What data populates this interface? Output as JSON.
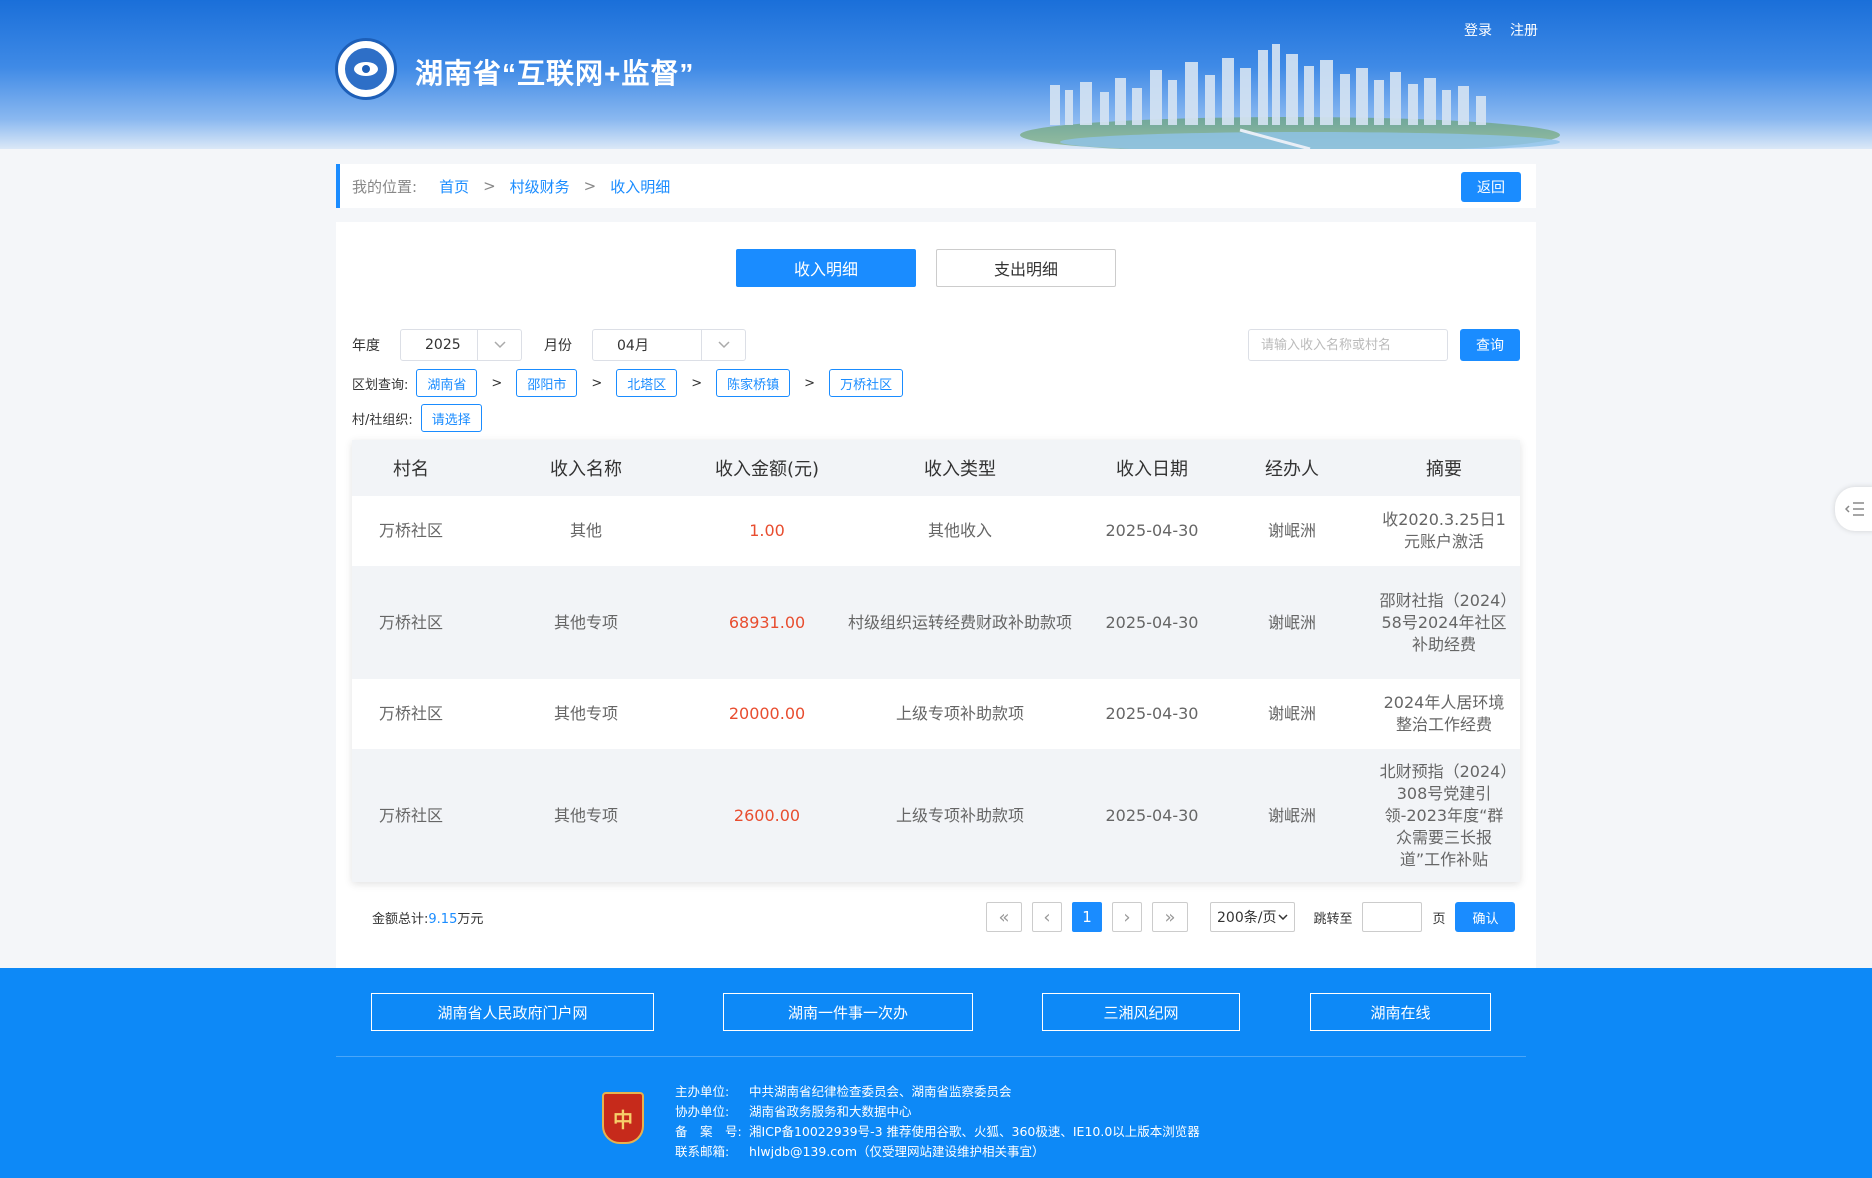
{
  "header": {
    "site_title": "湖南省“互联网+监督”",
    "login": "登录",
    "register": "注册"
  },
  "breadcrumb": {
    "label": "我的位置:",
    "items": [
      "首页",
      "村级财务",
      "收入明细"
    ],
    "separator": ">",
    "back": "返回"
  },
  "tabs": [
    {
      "label": "收入明细",
      "active": true
    },
    {
      "label": "支出明细",
      "active": false
    }
  ],
  "filters": {
    "year_label": "年度",
    "year_value": "2025",
    "month_label": "月份",
    "month_value": "04月",
    "search_placeholder": "请输入收入名称或村名",
    "query": "查询",
    "region_label": "区划查询:",
    "regions": [
      "湖南省",
      "邵阳市",
      "北塔区",
      "陈家桥镇",
      "万桥社区"
    ],
    "org_label": "村/社组织:",
    "org_value": "请选择"
  },
  "table": {
    "headers": [
      "村名",
      "收入名称",
      "收入金额(元)",
      "收入类型",
      "收入日期",
      "经办人",
      "摘要"
    ],
    "rows": [
      {
        "village": "万桥社区",
        "name": "其他",
        "amount": "1.00",
        "type": "其他收入",
        "date": "2025-04-30",
        "handler": "谢岷洲",
        "summary": "收2020.3.25日1元账户激活"
      },
      {
        "village": "万桥社区",
        "name": "其他专项",
        "amount": "68931.00",
        "type": "村级组织运转经费财政补助款项",
        "date": "2025-04-30",
        "handler": "谢岷洲",
        "summary": "邵财社指（2024）58号2024年社区补助经费"
      },
      {
        "village": "万桥社区",
        "name": "其他专项",
        "amount": "20000.00",
        "type": "上级专项补助款项",
        "date": "2025-04-30",
        "handler": "谢岷洲",
        "summary": "2024年人居环境整治工作经费"
      },
      {
        "village": "万桥社区",
        "name": "其他专项",
        "amount": "2600.00",
        "type": "上级专项补助款项",
        "date": "2025-04-30",
        "handler": "谢岷洲",
        "summary": "北财预指（2024）308号党建引领-2023年度“群众需要三长报道”工作补贴"
      }
    ]
  },
  "total": {
    "label": "金额总计:",
    "value": "9.15",
    "unit": "万元"
  },
  "pagination": {
    "first": "«",
    "prev": "‹",
    "current": "1",
    "next": "›",
    "last": "»",
    "page_size": "200条/页",
    "goto_label": "跳转至",
    "page_unit": "页",
    "confirm": "确认"
  },
  "footer": {
    "links": [
      "湖南省人民政府门户网",
      "湖南一件事一次办",
      "三湘风纪网",
      "湖南在线"
    ],
    "info": [
      {
        "k": "主办单位:",
        "v": "中共湖南省纪律检查委员会、湖南省监察委员会"
      },
      {
        "k": "协办单位:",
        "v": "湖南省政务服务和大数据中心"
      },
      {
        "k": "备　案　号:",
        "v": "湘ICP备10022939号-3   推荐使用谷歌、火狐、360极速、IE10.0以上版本浏览器"
      },
      {
        "k": "联系邮箱:",
        "v": "hlwjdb@139.com（仅受理网站建设维护相关事宜）"
      }
    ]
  },
  "colors": {
    "accent": "#1a8cff",
    "amount": "#e84d2f",
    "footer_bg": "#0d89f7"
  }
}
